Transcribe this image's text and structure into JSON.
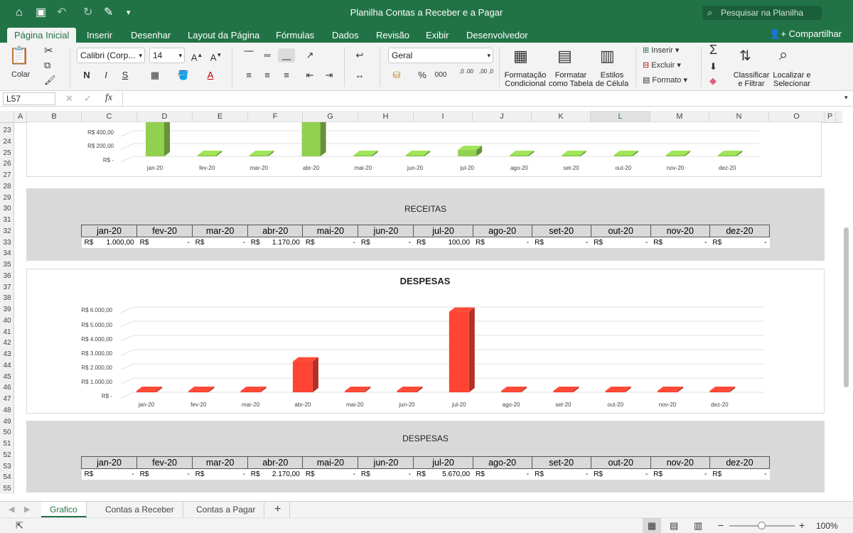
{
  "window": {
    "title": "Planilha Contas a Receber e a Pagar",
    "search_placeholder": "Pesquisar na Planilha"
  },
  "ribbon_tabs": [
    "Página Inicial",
    "Inserir",
    "Desenhar",
    "Layout da Página",
    "Fórmulas",
    "Dados",
    "Revisão",
    "Exibir",
    "Desenvolvedor"
  ],
  "share_label": "Compartilhar",
  "ribbon": {
    "paste_label": "Colar",
    "font_name": "Calibri (Corp...",
    "font_size": "14",
    "bold": "N",
    "italic": "I",
    "underline": "S",
    "number_format": "Geral",
    "percent": "%",
    "thousands": "000",
    "dec_increase": ",0 .00",
    "dec_decrease": ",00 ,0",
    "conditional_format": [
      "Formatação",
      "Condicional"
    ],
    "format_table": [
      "Formatar",
      "como Tabela"
    ],
    "cell_styles": [
      "Estilos",
      "de Célula"
    ],
    "insert": "Inserir",
    "delete": "Excluir",
    "format": "Formato",
    "sort_filter": [
      "Classificar",
      "e Filtrar"
    ],
    "find_select": [
      "Localizar e",
      "Selecionar"
    ]
  },
  "formula_bar": {
    "cell_ref": "L57",
    "fx": "fx",
    "content": ""
  },
  "columns": [
    "A",
    "B",
    "C",
    "D",
    "E",
    "F",
    "G",
    "H",
    "I",
    "J",
    "K",
    "L",
    "M",
    "N",
    "O",
    "P"
  ],
  "selected_column": "L",
  "rows": [
    "23",
    "24",
    "25",
    "26",
    "27",
    "28",
    "29",
    "30",
    "31",
    "32",
    "33",
    "34",
    "35",
    "36",
    "37",
    "38",
    "39",
    "40",
    "41",
    "42",
    "43",
    "44",
    "45",
    "46",
    "47",
    "48",
    "49",
    "50",
    "51",
    "52",
    "53",
    "54",
    "55"
  ],
  "months": [
    "jan-20",
    "fev-20",
    "mar-20",
    "abr-20",
    "mai-20",
    "jun-20",
    "jul-20",
    "ago-20",
    "set-20",
    "out-20",
    "nov-20",
    "dez-20"
  ],
  "chart_data": [
    {
      "type": "bar",
      "title": "",
      "categories": [
        "jan-20",
        "fev-20",
        "mar-20",
        "abr-20",
        "mai-20",
        "jun-20",
        "jul-20",
        "ago-20",
        "set-20",
        "out-20",
        "nov-20",
        "dez-20"
      ],
      "values": [
        1000,
        0,
        0,
        1170,
        0,
        0,
        100,
        0,
        0,
        0,
        0,
        0
      ],
      "y_tick_labels_visible": [
        "R$ 400,00",
        "R$ 200,00",
        "R$ -"
      ],
      "color": "#92d050"
    },
    {
      "type": "bar",
      "title": "DESPESAS",
      "categories": [
        "jan-20",
        "fev-20",
        "mar-20",
        "abr-20",
        "mai-20",
        "jun-20",
        "jul-20",
        "ago-20",
        "set-20",
        "out-20",
        "nov-20",
        "dez-20"
      ],
      "values": [
        0,
        0,
        0,
        2170,
        0,
        0,
        5670,
        0,
        0,
        0,
        0,
        0
      ],
      "ylim": [
        0,
        6000
      ],
      "y_tick_labels": [
        "R$ 6.000,00",
        "R$ 5.000,00",
        "R$ 4.000,00",
        "R$ 3.000,00",
        "R$ 2.000,00",
        "R$ 1.000,00",
        "R$ -"
      ],
      "color": "#ff4433",
      "grid": true
    }
  ],
  "receitas": {
    "title": "RECEITAS",
    "currency": "R$",
    "values": [
      "1.000,00",
      "-",
      "-",
      "1.170,00",
      "-",
      "-",
      "100,00",
      "-",
      "-",
      "-",
      "-",
      "-"
    ]
  },
  "despesas": {
    "title": "DESPESAS",
    "currency": "R$",
    "values": [
      "-",
      "-",
      "-",
      "2.170,00",
      "-",
      "-",
      "5.670,00",
      "-",
      "-",
      "-",
      "-",
      "-"
    ]
  },
  "sheet_tabs": [
    "Grafico",
    "Contas a Receber",
    "Contas a Pagar"
  ],
  "active_sheet": "Grafico",
  "add_sheet": "+",
  "zoom": "100%"
}
